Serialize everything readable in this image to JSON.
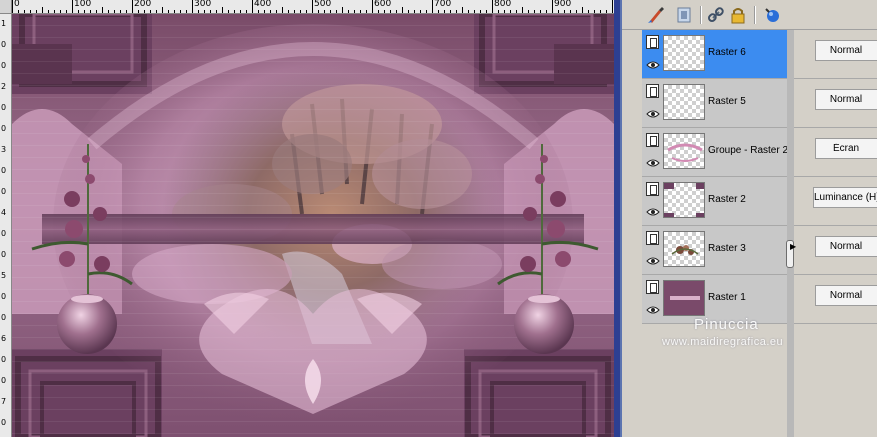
{
  "ruler": {
    "top_labels": [
      "0",
      "100",
      "200",
      "300",
      "400",
      "500",
      "600",
      "700",
      "800",
      "900"
    ],
    "left_labels": [
      "1",
      "0",
      "0",
      "2",
      "0",
      "0",
      "3",
      "0",
      "0",
      "4",
      "0",
      "0",
      "5",
      "0",
      "0",
      "6",
      "0",
      "0",
      "7",
      "0"
    ]
  },
  "canvas": {
    "description_icon": "image-canvas",
    "colors": {
      "background": "#8a5877",
      "frame_dark": "#5b3850",
      "frame_mid": "#7c4c6b",
      "pink_light": "#d9a7c5",
      "ruler_bg": "#e9e9e9",
      "window_frame": "#2d3f92"
    }
  },
  "palette": {
    "toolbar": {
      "tools": [
        {
          "icon": "brush-icon"
        },
        {
          "icon": "mask-icon"
        },
        {
          "icon": "link-icon"
        },
        {
          "icon": "lock-icon"
        },
        {
          "icon": "blend-icon"
        }
      ]
    },
    "layers": [
      {
        "name": "Raster 6",
        "blend": "Normal",
        "selected": true,
        "thumb": "transparent"
      },
      {
        "name": "Raster 5",
        "blend": "Normal",
        "selected": false,
        "thumb": "transparent"
      },
      {
        "name": "Groupe - Raster 2",
        "blend": "Écran",
        "selected": false,
        "thumb": "pink-lines"
      },
      {
        "name": "Raster 2",
        "blend": "Luminance (H)",
        "selected": false,
        "thumb": "corners"
      },
      {
        "name": "Raster 3",
        "blend": "Normal",
        "selected": false,
        "thumb": "flowers"
      },
      {
        "name": "Raster 1",
        "blend": "Normal",
        "selected": false,
        "thumb": "solid-mauve"
      }
    ],
    "colors": {
      "selected_row": "#3c8cf0",
      "row_bg": "#c8c8c8",
      "panel_bg": "#d4d0c8"
    }
  },
  "watermark": {
    "name": "Pinuccia",
    "site": "www.maidiregrafica.eu"
  }
}
